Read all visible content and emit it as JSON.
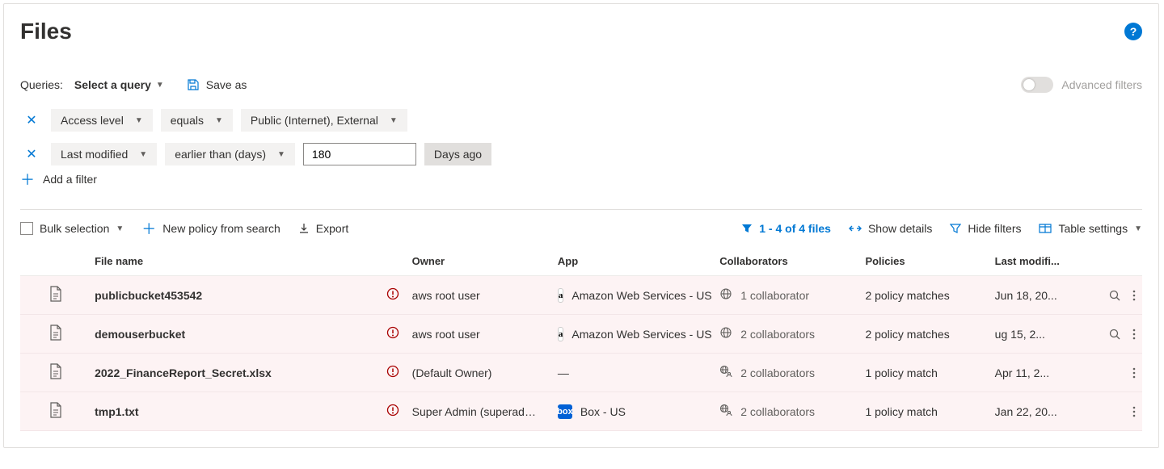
{
  "title": "Files",
  "queries_label": "Queries:",
  "query_selector": "Select a query",
  "save_as": "Save as",
  "advanced_filters": "Advanced filters",
  "filters": [
    {
      "field": "Access level",
      "operator": "equals",
      "value": "Public (Internet), External",
      "value_is_input": false,
      "suffix": ""
    },
    {
      "field": "Last modified",
      "operator": "earlier than (days)",
      "value": "180",
      "value_is_input": true,
      "suffix": "Days ago"
    }
  ],
  "add_filter": "Add a filter",
  "table_toolbar": {
    "bulk_selection": "Bulk selection",
    "new_policy": "New policy from search",
    "export": "Export",
    "count": "1 - 4 of 4 files",
    "show_details": "Show details",
    "hide_filters": "Hide filters",
    "table_settings": "Table settings"
  },
  "columns": {
    "file_name": "File name",
    "owner": "Owner",
    "app": "App",
    "collaborators": "Collaborators",
    "policies": "Policies",
    "last_modified": "Last modifi..."
  },
  "rows": [
    {
      "name": "publicbucket453542",
      "owner": "aws root user",
      "app": "Amazon Web Services - US",
      "app_icon": "aws",
      "collab_icon": "globe",
      "collaborators": "1 collaborator",
      "policies": "2 policy matches",
      "modified": "Jun 18, 20...",
      "has_search": true
    },
    {
      "name": "demouserbucket",
      "owner": "aws root user",
      "app": "Amazon Web Services - US",
      "app_icon": "aws",
      "collab_icon": "globe",
      "collaborators": "2 collaborators",
      "policies": "2 policy matches",
      "modified": "ug 15, 2...",
      "has_search": true
    },
    {
      "name": "2022_FinanceReport_Secret.xlsx",
      "owner": "(Default Owner)",
      "app": "—",
      "app_icon": "",
      "collab_icon": "user-globe",
      "collaborators": "2 collaborators",
      "policies": "1 policy match",
      "modified": "Apr 11, 2...",
      "has_search": false
    },
    {
      "name": "tmp1.txt",
      "owner": "Super Admin (superadmin@c...",
      "app": "Box - US",
      "app_icon": "box",
      "collab_icon": "user-globe",
      "collaborators": "2 collaborators",
      "policies": "1 policy match",
      "modified": "Jan 22, 20...",
      "has_search": false
    }
  ]
}
